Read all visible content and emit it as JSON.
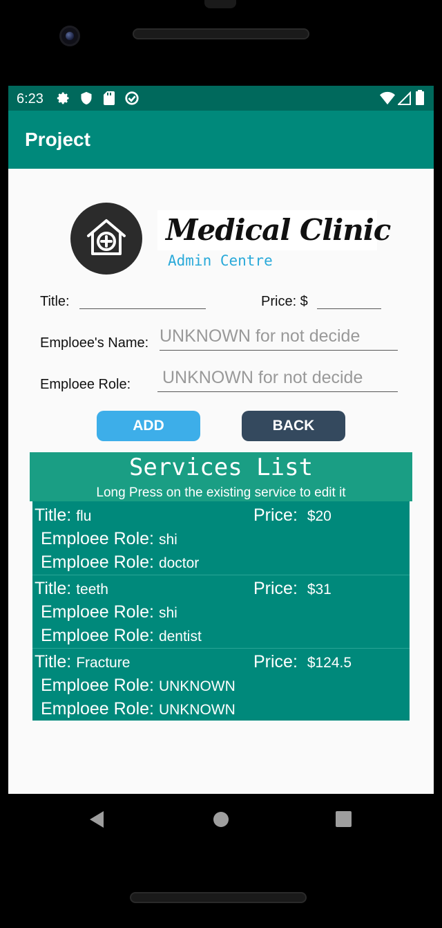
{
  "status_bar": {
    "time": "6:23"
  },
  "app_bar": {
    "title": "Project"
  },
  "logo": {
    "brand": "Medical Clinic",
    "subtitle": "Admin Centre"
  },
  "form": {
    "title_label": "Title:",
    "price_label": "Price:  $",
    "employee_name_label": "Emploee's Name:",
    "employee_name_placeholder": "UNKNOWN for not decide",
    "employee_role_label": "Emploee Role:",
    "employee_role_placeholder": "UNKNOWN for not decide"
  },
  "buttons": {
    "add": "ADD",
    "back": "BACK"
  },
  "services": {
    "header": "Services List",
    "hint": "Long Press on the  existing service to edit it",
    "title_label": "Title:",
    "price_label": "Price:",
    "role_label": "Emploee Role:",
    "items": [
      {
        "title": "flu",
        "price": "$20",
        "role1": "shi",
        "role2": "doctor"
      },
      {
        "title": "teeth",
        "price": "$31",
        "role1": "shi",
        "role2": "dentist"
      },
      {
        "title": "Fracture",
        "price": "$124.5",
        "role1": "UNKNOWN",
        "role2": "UNKNOWN"
      }
    ]
  },
  "colors": {
    "status_bar": "#00695c",
    "app_bar": "#00897b",
    "list_header": "#1a9e84",
    "list_bg": "#00897b",
    "add_button": "#3daee9",
    "back_button": "#34495e"
  },
  "icons": [
    "settings-icon",
    "shield-icon",
    "sd-card-icon",
    "data-saver-icon",
    "wifi-icon",
    "signal-icon",
    "battery-icon",
    "home-plus-icon",
    "nav-back-icon",
    "nav-home-icon",
    "nav-recents-icon"
  ]
}
